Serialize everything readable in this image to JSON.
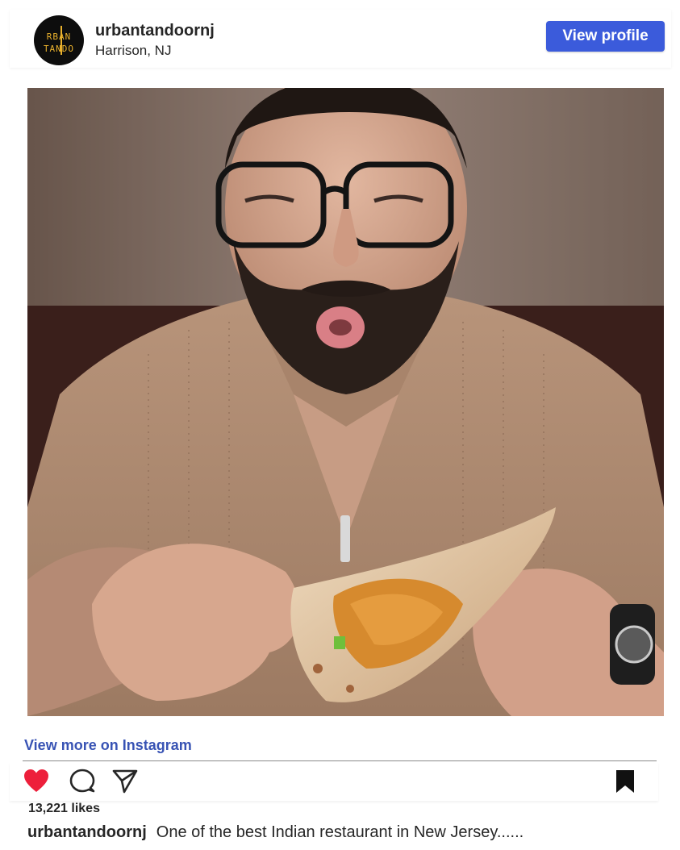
{
  "post": {
    "username": "urbantandoornj",
    "location": "Harrison, NJ",
    "view_profile_label": "View profile",
    "avatar": {
      "line1": "RBAN",
      "line2": "TANDO",
      "colors": {
        "background": "#0d0d0d",
        "lettering": "#e9b12d"
      }
    },
    "photo": {
      "icon": "post-photo"
    },
    "view_more_label": "View more on Instagram",
    "likes": "13,221 likes",
    "caption": {
      "username": "urbantandoornj",
      "text": "One of the best Indian restaurant in New Jersey......"
    },
    "actions": {
      "like_icon": "heart-filled-icon",
      "comment_icon": "comment-icon",
      "share_icon": "share-icon",
      "save_icon": "bookmark-icon"
    },
    "colors": {
      "accent": "#3b5bdb",
      "link": "#3853b4",
      "like": "#ed1f3b",
      "text": "#262626"
    }
  }
}
